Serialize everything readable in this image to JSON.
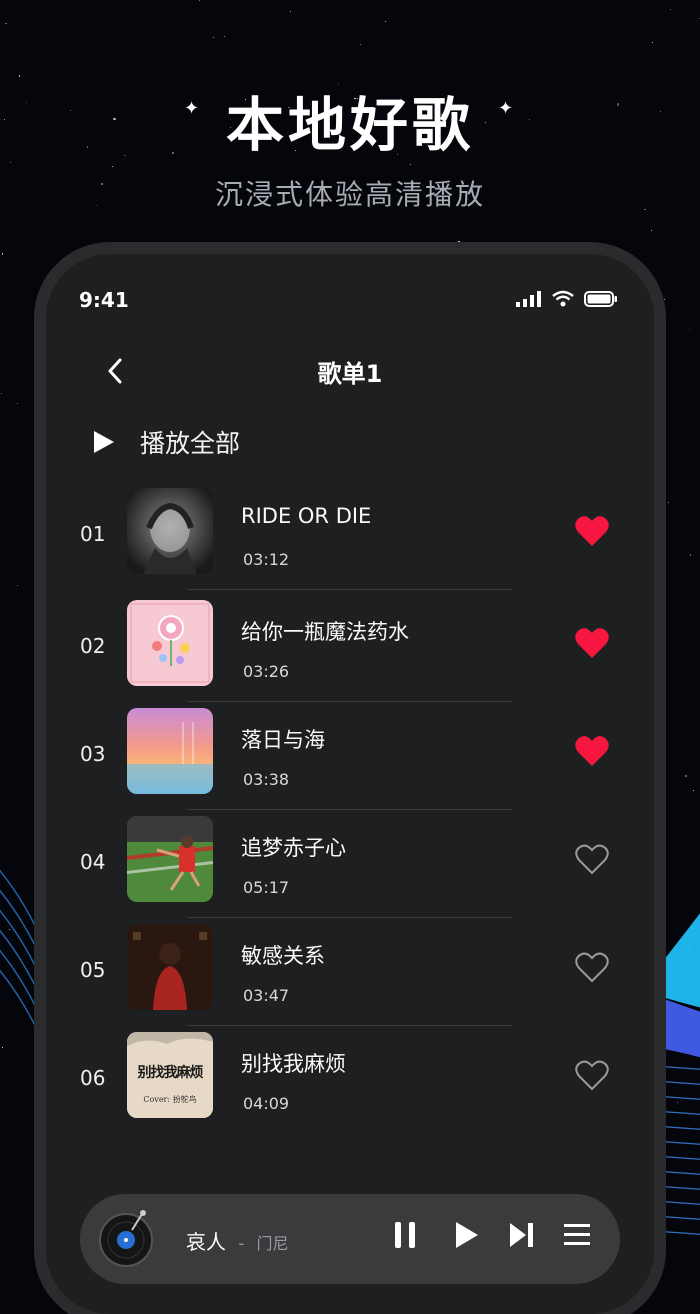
{
  "hero": {
    "title": "本地好歌",
    "subtitle": "沉浸式体验高清播放"
  },
  "status_bar": {
    "time": "9:41"
  },
  "nav": {
    "title": "歌单1",
    "back_icon": "chevron-left-icon"
  },
  "play_all": {
    "label": "播放全部",
    "icon": "play-icon"
  },
  "songs": [
    {
      "index": "01",
      "title": "RIDE OR DIE",
      "duration": "03:12",
      "liked": true
    },
    {
      "index": "02",
      "title": "给你一瓶魔法药水",
      "duration": "03:26",
      "liked": true
    },
    {
      "index": "03",
      "title": "落日与海",
      "duration": "03:38",
      "liked": true
    },
    {
      "index": "04",
      "title": "追梦赤子心",
      "duration": "05:17",
      "liked": false
    },
    {
      "index": "05",
      "title": "敏感关系",
      "duration": "03:47",
      "liked": false
    },
    {
      "index": "06",
      "title": "别找我麻烦",
      "duration": "04:09",
      "liked": false
    }
  ],
  "covers": {
    "c6_text": "别找我麻烦",
    "c6_sub": "Cover: 扮鸵鸟"
  },
  "now_playing": {
    "title": "哀人",
    "separator": "-",
    "artist": "门尼"
  },
  "colors": {
    "heart_active": "#f5173f",
    "heart_inactive": "#9a9b9d",
    "panel_bg": "#1e1f20"
  }
}
